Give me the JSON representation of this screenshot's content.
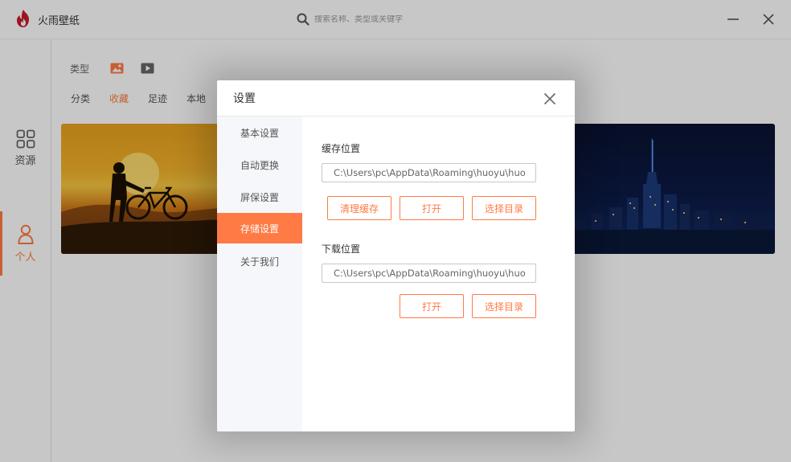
{
  "app": {
    "title": "火雨壁纸",
    "search_placeholder": "搜索名称、类型或关键字"
  },
  "left_nav": {
    "items": [
      {
        "label": "资源",
        "icon": "grid-icon",
        "active": false
      },
      {
        "label": "个人",
        "icon": "user-icon",
        "active": true
      }
    ]
  },
  "content": {
    "filter_label": "类型",
    "type_icons": [
      "image-icon",
      "video-icon"
    ],
    "tabs": [
      {
        "label": "分类",
        "active": false
      },
      {
        "label": "收藏",
        "active": true
      },
      {
        "label": "足迹",
        "active": false
      },
      {
        "label": "本地",
        "active": false
      }
    ]
  },
  "dialog": {
    "title": "设置",
    "menu": [
      {
        "label": "基本设置",
        "active": false
      },
      {
        "label": "自动更换",
        "active": false
      },
      {
        "label": "屏保设置",
        "active": false
      },
      {
        "label": "存储设置",
        "active": true
      },
      {
        "label": "关于我们",
        "active": false
      }
    ],
    "cache": {
      "title": "缓存位置",
      "path": "C:\\Users\\pc\\AppData\\Roaming\\huoyu\\huo",
      "clear_label": "清理缓存",
      "open_label": "打开",
      "choose_label": "选择目录"
    },
    "download": {
      "title": "下载位置",
      "path": "C:\\Users\\pc\\AppData\\Roaming\\huoyu\\huo",
      "open_label": "打开",
      "choose_label": "选择目录"
    }
  },
  "colors": {
    "accent": "#ff7a45",
    "sidebar_bg": "#f5f7fa",
    "overlay": "rgba(0,0,0,0.22)"
  }
}
